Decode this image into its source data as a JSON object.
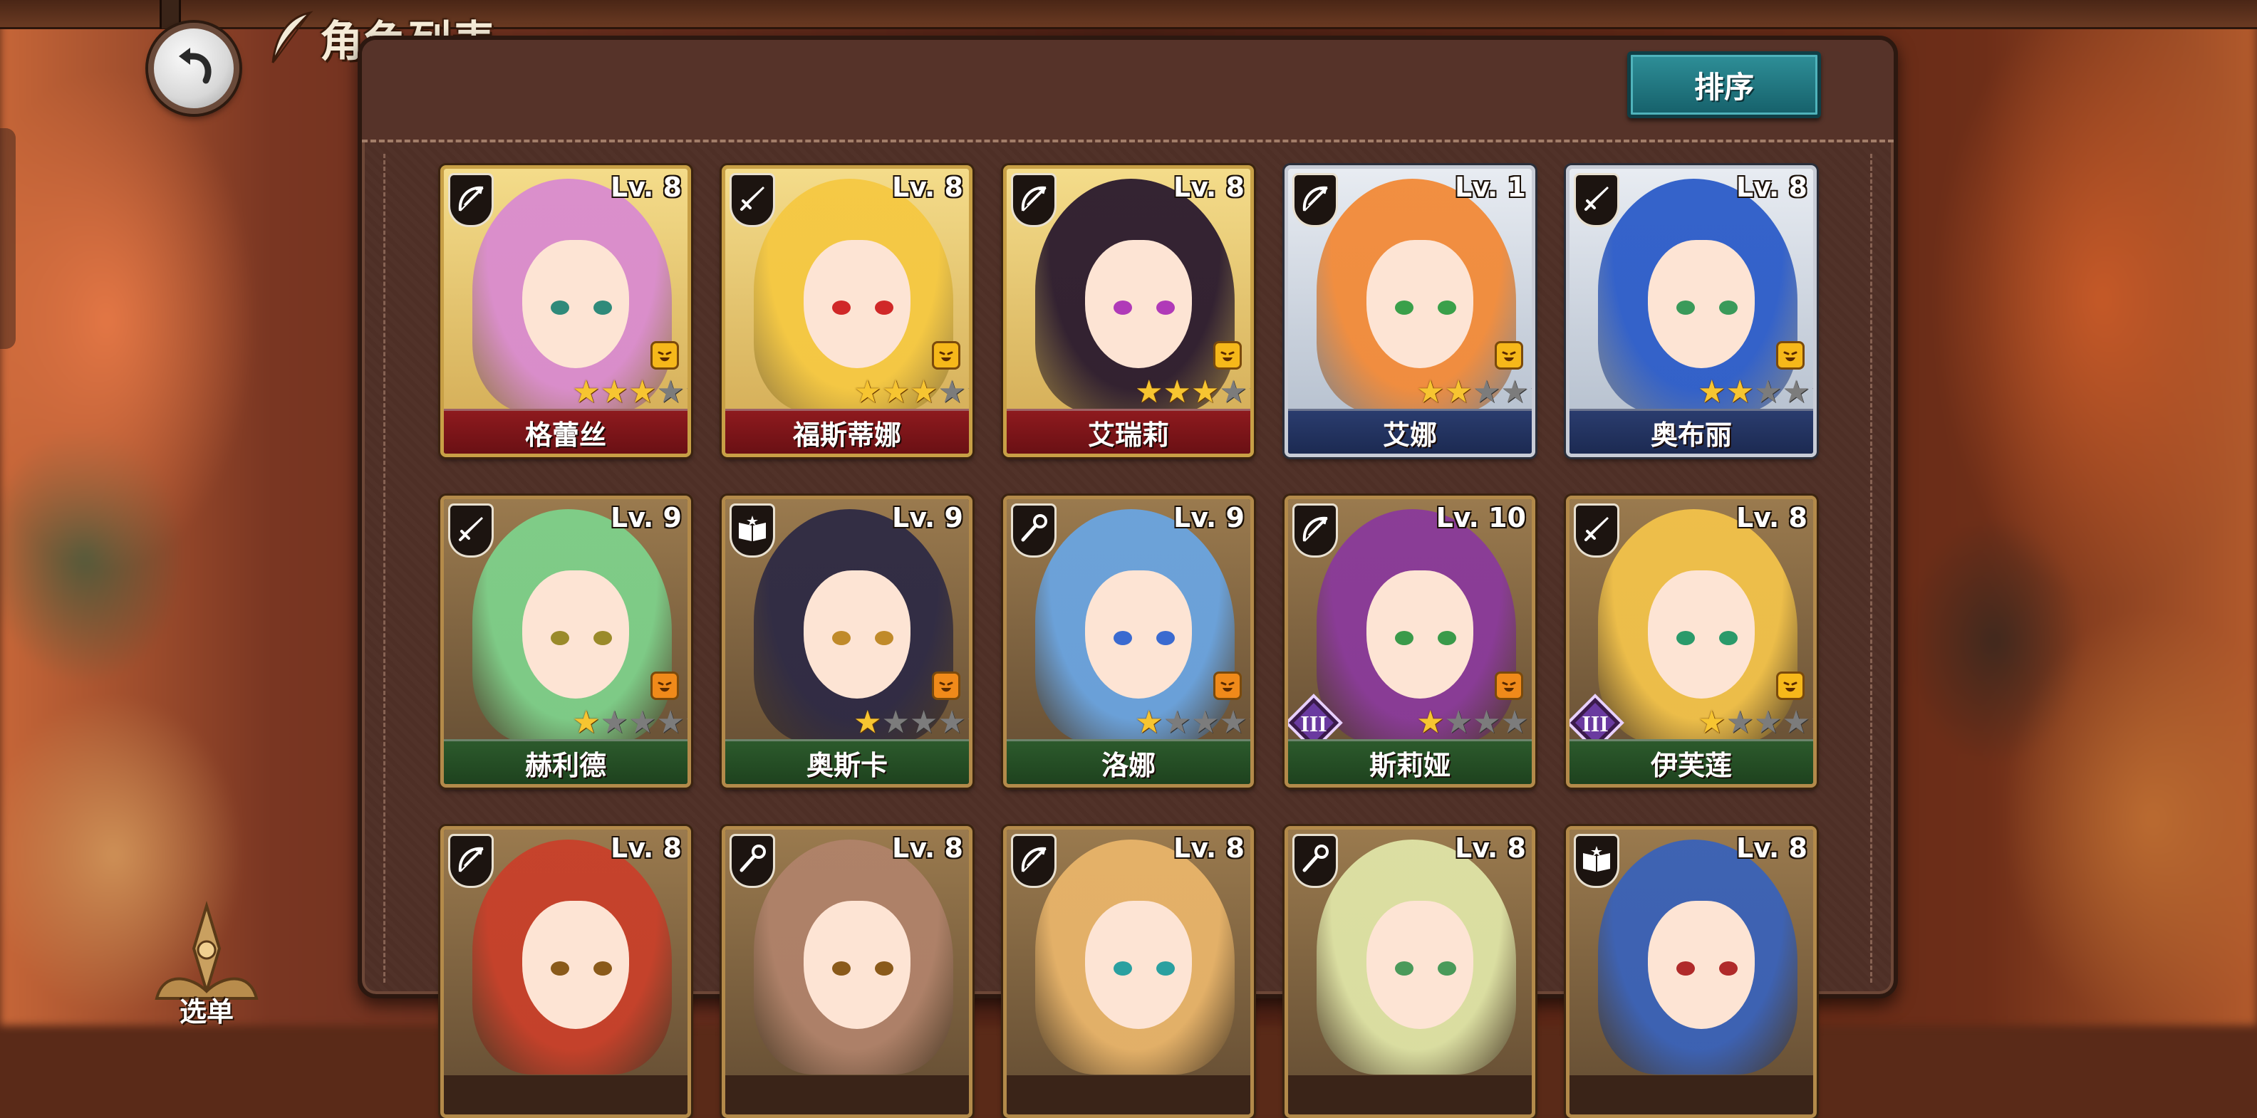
{
  "header": {
    "title": "角色列表",
    "sort_label": "排序"
  },
  "menu": {
    "label": "选单"
  },
  "colors": {
    "gold_frame": "#c8a046",
    "silver_frame": "#c8ccd6",
    "name_red": "#8e1a1e",
    "name_blue": "#2a3c6e",
    "name_green": "#2c5a2c",
    "sort_button": "#1f7a84"
  },
  "characters": [
    {
      "name": "格蕾丝",
      "level": "Lv. 8",
      "class_icon": "bow-icon",
      "stars": 3,
      "max_stars": 5,
      "rarity": "gold",
      "bar": "red",
      "rank": "",
      "hair": "#d98bcf",
      "eyes": "#2f8a7a",
      "mood": "yellow"
    },
    {
      "name": "福斯蒂娜",
      "level": "Lv. 8",
      "class_icon": "sword-icon",
      "stars": 3,
      "max_stars": 5,
      "rarity": "gold",
      "bar": "red",
      "rank": "",
      "hair": "#f5c842",
      "eyes": "#d02828",
      "mood": "yellow"
    },
    {
      "name": "艾瑞莉",
      "level": "Lv. 8",
      "class_icon": "bow-icon",
      "stars": 3,
      "max_stars": 5,
      "rarity": "gold",
      "bar": "red",
      "rank": "",
      "hair": "#2a1a2e",
      "eyes": "#b03ab8",
      "mood": "yellow"
    },
    {
      "name": "艾娜",
      "level": "Lv. 1",
      "class_icon": "bow-icon",
      "stars": 2,
      "max_stars": 5,
      "rarity": "silver",
      "bar": "blue",
      "rank": "",
      "hair": "#f28a38",
      "eyes": "#3aa04a",
      "mood": "yellow"
    },
    {
      "name": "奥布丽",
      "level": "Lv. 8",
      "class_icon": "sword-icon",
      "stars": 2,
      "max_stars": 5,
      "rarity": "silver",
      "bar": "blue",
      "rank": "",
      "hair": "#2c5cc8",
      "eyes": "#3a9a5a",
      "mood": "yellow"
    },
    {
      "name": "赫利德",
      "level": "Lv. 9",
      "class_icon": "sword-icon",
      "stars": 1,
      "max_stars": 5,
      "rarity": "bronze",
      "bar": "green",
      "rank": "",
      "hair": "#7ed08a",
      "eyes": "#9a8a2a",
      "mood": "orange"
    },
    {
      "name": "奥斯卡",
      "level": "Lv. 9",
      "class_icon": "book-icon",
      "stars": 1,
      "max_stars": 5,
      "rarity": "bronze",
      "bar": "green",
      "rank": "",
      "hair": "#2e2a44",
      "eyes": "#c08a2a",
      "mood": "orange"
    },
    {
      "name": "洛娜",
      "level": "Lv. 9",
      "class_icon": "staff-icon",
      "stars": 1,
      "max_stars": 5,
      "rarity": "bronze",
      "bar": "green",
      "rank": "",
      "hair": "#6aa4e0",
      "eyes": "#3a6ad0",
      "mood": "orange"
    },
    {
      "name": "斯莉娅",
      "level": "Lv. 10",
      "class_icon": "bow-icon",
      "stars": 1,
      "max_stars": 5,
      "rarity": "bronze",
      "bar": "green",
      "rank": "III",
      "hair": "#8a3a9a",
      "eyes": "#3a9a4a",
      "mood": "orange"
    },
    {
      "name": "伊芙莲",
      "level": "Lv. 8",
      "class_icon": "sword-icon",
      "stars": 1,
      "max_stars": 5,
      "rarity": "bronze",
      "bar": "green",
      "rank": "III",
      "hair": "#f2c24a",
      "eyes": "#2a9a6a",
      "mood": "yellow"
    },
    {
      "name": "",
      "level": "Lv. 8",
      "class_icon": "bow-icon",
      "stars": 0,
      "max_stars": 5,
      "rarity": "bronze",
      "bar": "",
      "rank": "",
      "hair": "#c8402a",
      "eyes": "#8a5a1a",
      "mood": ""
    },
    {
      "name": "",
      "level": "Lv. 8",
      "class_icon": "staff-icon",
      "stars": 0,
      "max_stars": 5,
      "rarity": "bronze",
      "bar": "",
      "rank": "",
      "hair": "#b0826a",
      "eyes": "#8a5a1a",
      "mood": ""
    },
    {
      "name": "",
      "level": "Lv. 8",
      "class_icon": "bow-icon",
      "stars": 0,
      "max_stars": 5,
      "rarity": "bronze",
      "bar": "",
      "rank": "",
      "hair": "#e8b46a",
      "eyes": "#2aa0a0",
      "mood": ""
    },
    {
      "name": "",
      "level": "Lv. 8",
      "class_icon": "staff-icon",
      "stars": 0,
      "max_stars": 5,
      "rarity": "bronze",
      "bar": "",
      "rank": "",
      "hair": "#dfe4a6",
      "eyes": "#4a9a5a",
      "mood": ""
    },
    {
      "name": "",
      "level": "Lv. 8",
      "class_icon": "book-icon",
      "stars": 0,
      "max_stars": 5,
      "rarity": "bronze",
      "bar": "",
      "rank": "",
      "hair": "#3a62b8",
      "eyes": "#b02a2a",
      "mood": ""
    }
  ]
}
